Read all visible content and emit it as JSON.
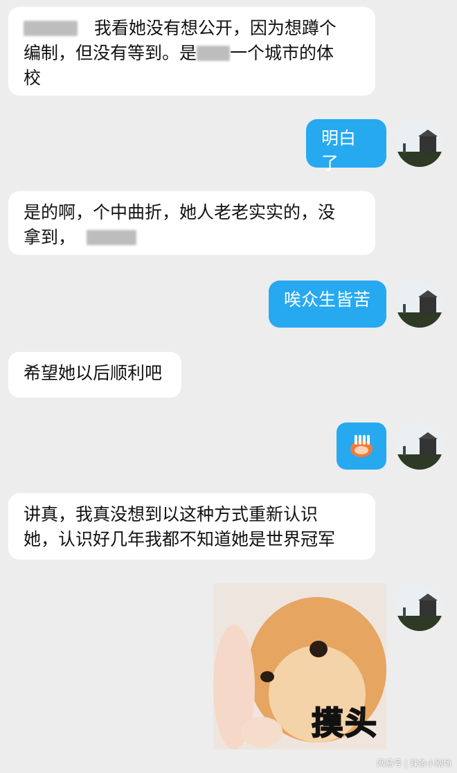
{
  "messages": [
    {
      "side": "in",
      "text_a": "我看她没有想公开，因为想蹲个",
      "text_b": "编制，但没有等到。是",
      "text_c": "一个城市的体",
      "text_d": "校"
    },
    {
      "side": "out",
      "text": "明白了"
    },
    {
      "side": "in",
      "text_a": "是的啊，个中曲折，她人老老实实的，没",
      "text_b": "拿到，"
    },
    {
      "side": "out",
      "text": "唉众生皆苦"
    },
    {
      "side": "in",
      "text": "希望她以后顺利吧"
    },
    {
      "side": "out",
      "sticker": "peace-hands-emoji"
    },
    {
      "side": "in",
      "text_a": "讲真，我真没想到以这种方式重新认识",
      "text_b": "她，认识好几年我都不知道她是世界冠军"
    },
    {
      "side": "out",
      "image_caption": "摸头"
    }
  ],
  "watermark": "网易号 | 辣条小剧场",
  "colors": {
    "background": "#ededed",
    "outgoing": "#27a9f0",
    "incoming": "#ffffff"
  }
}
